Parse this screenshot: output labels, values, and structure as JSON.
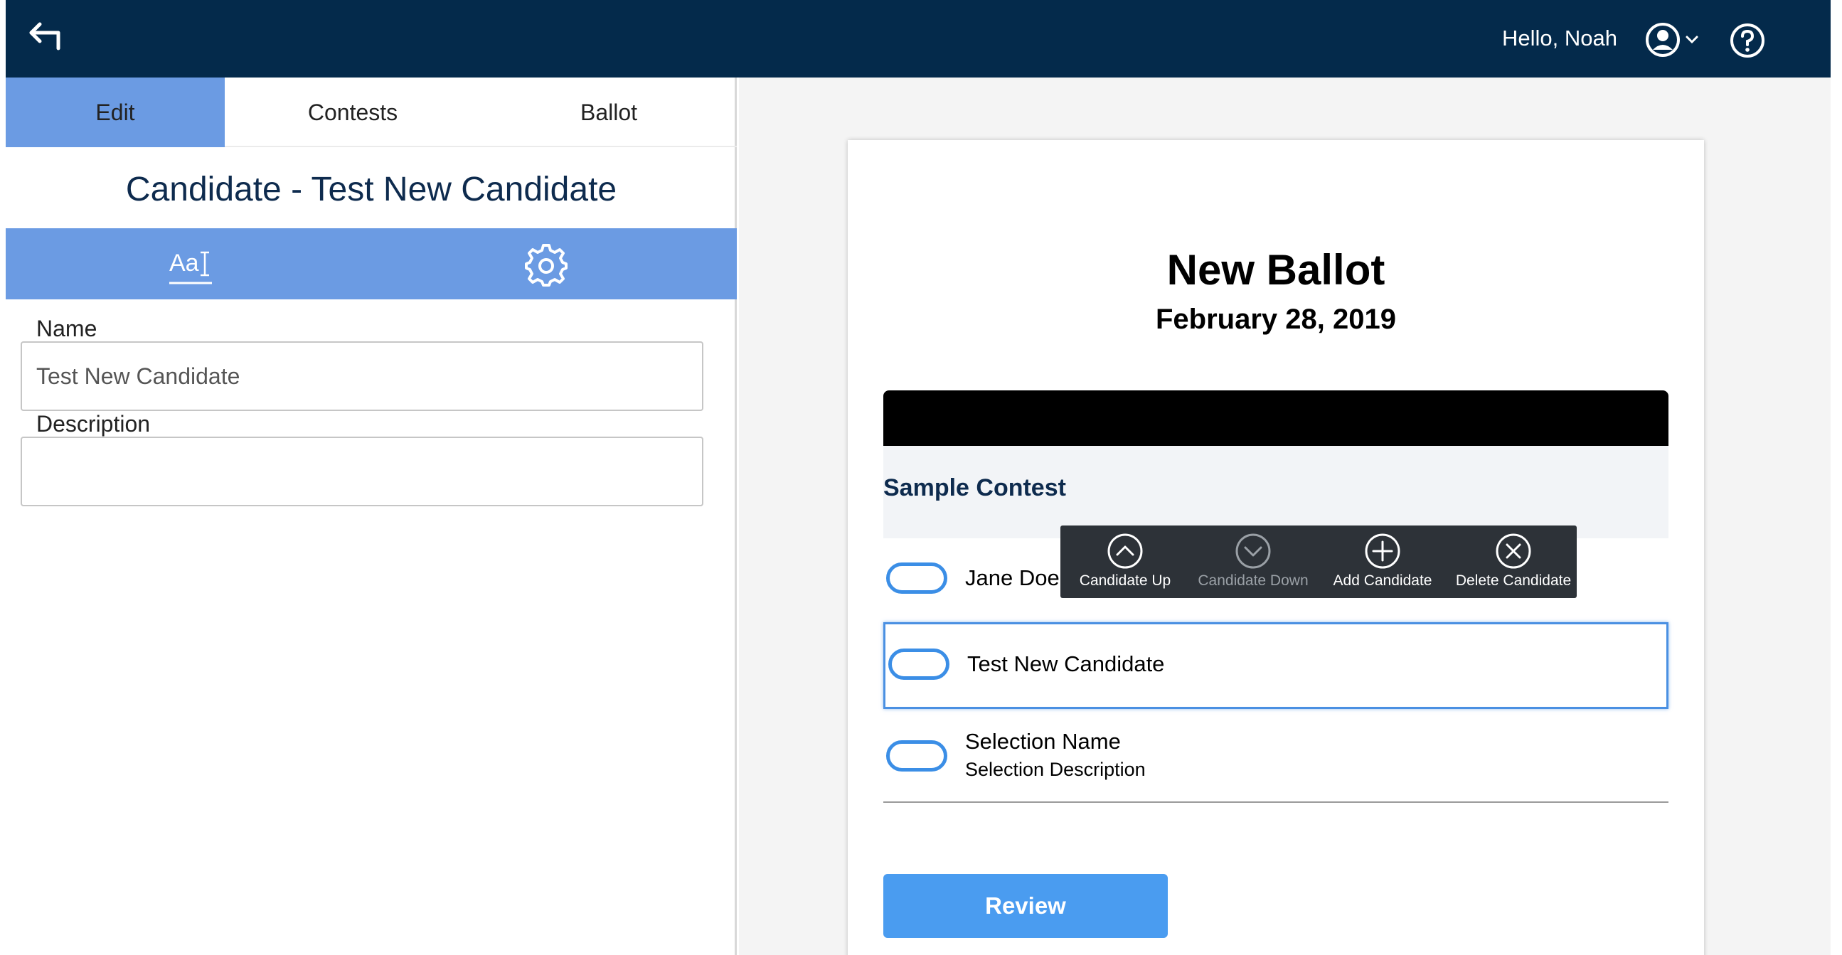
{
  "header": {
    "greeting": "Hello, Noah",
    "icons": {
      "back": "back-arrow-icon",
      "user": "user-circle-icon",
      "help": "help-icon"
    }
  },
  "tabs": [
    {
      "label": "Edit",
      "active": true
    },
    {
      "label": "Contests",
      "active": false
    },
    {
      "label": "Ballot",
      "active": false
    }
  ],
  "panel": {
    "title": "Candidate - Test New Candidate",
    "subtabs": [
      {
        "icon": "text-format-icon",
        "glyph": "Aa",
        "active": true
      },
      {
        "icon": "gear-icon",
        "active": false
      }
    ],
    "name_label": "Name",
    "name_value": "Test New Candidate",
    "description_label": "Description",
    "description_value": ""
  },
  "ballot": {
    "title": "New Ballot",
    "date": "February 28, 2019",
    "contest": {
      "name": "Sample Contest",
      "candidates": [
        {
          "name": "Jane Doe",
          "description": "",
          "selected": false
        },
        {
          "name": "Test New Candidate",
          "description": "",
          "selected": true
        },
        {
          "name": "Selection Name",
          "description": "Selection Description",
          "selected": false
        }
      ]
    },
    "toolbar": [
      {
        "label": "Candidate Up",
        "icon": "chevron-up-circle-icon",
        "enabled": true
      },
      {
        "label": "Candidate Down",
        "icon": "chevron-down-circle-icon",
        "enabled": false
      },
      {
        "label": "Add Candidate",
        "icon": "plus-circle-icon",
        "enabled": true
      },
      {
        "label": "Delete Candidate",
        "icon": "x-circle-icon",
        "enabled": true
      }
    ],
    "review_label": "Review"
  },
  "colors": {
    "topbar": "#042a4b",
    "tab_active": "#6b9be3",
    "oval": "#3b8ee6",
    "review": "#4a9cf0",
    "toolbar": "#2d3238"
  }
}
